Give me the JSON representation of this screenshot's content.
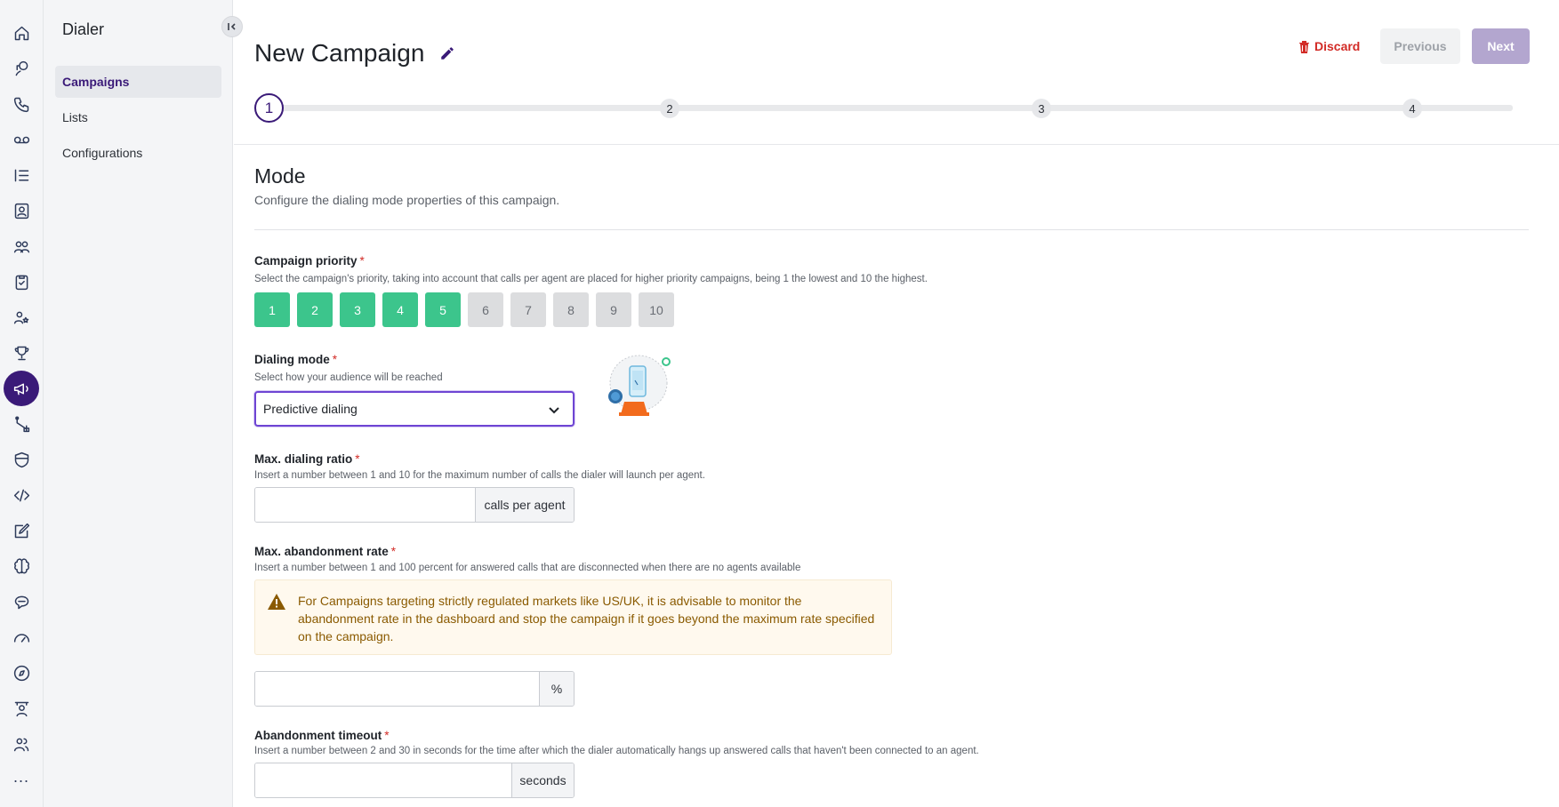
{
  "rail": {
    "icons": [
      "home-icon",
      "agent-icon",
      "phone-icon",
      "voicemail-icon",
      "list-icon",
      "contacts-icon",
      "team-icon",
      "clipboard-icon",
      "users-star-icon",
      "trophy-icon",
      "megaphone-icon",
      "workflow-icon",
      "shield-icon",
      "code-icon",
      "edit-icon",
      "brain-icon",
      "chat-icon",
      "gauge-icon",
      "compass-icon",
      "teacher-icon",
      "people-icon"
    ],
    "more": "..."
  },
  "sidebar": {
    "title": "Dialer",
    "items": [
      {
        "label": "Campaigns",
        "active": true
      },
      {
        "label": "Lists",
        "active": false
      },
      {
        "label": "Configurations",
        "active": false
      }
    ]
  },
  "header": {
    "title": "New Campaign",
    "discard_label": "Discard",
    "previous_label": "Previous",
    "next_label": "Next"
  },
  "stepper": {
    "steps": [
      "1",
      "2",
      "3",
      "4"
    ],
    "current": 1
  },
  "section": {
    "title": "Mode",
    "subtitle": "Configure the dialing mode properties of this campaign."
  },
  "priority": {
    "label": "Campaign priority",
    "required": "*",
    "help": "Select the campaign's priority, taking into account that calls per agent are placed for higher priority campaigns, being 1 the lowest and 10 the highest.",
    "options": [
      "1",
      "2",
      "3",
      "4",
      "5",
      "6",
      "7",
      "8",
      "9",
      "10"
    ],
    "selected": 5
  },
  "dialing_mode": {
    "label": "Dialing mode",
    "required": "*",
    "help": "Select how your audience will be reached",
    "value": "Predictive dialing"
  },
  "max_ratio": {
    "label": "Max. dialing ratio",
    "required": "*",
    "help": "Insert a number between 1 and 10 for the maximum number of calls the dialer will launch per agent.",
    "value": "",
    "addon": "calls per agent"
  },
  "abandon_rate": {
    "label": "Max. abandonment rate",
    "required": "*",
    "help": "Insert a number between 1 and 100 percent for answered calls that are disconnected when there are no agents available",
    "warning": "For Campaigns targeting strictly regulated markets like US/UK, it is advisable to monitor the abandonment rate in the dashboard and stop the campaign if it goes beyond the maximum rate specified on the campaign.",
    "value": "",
    "addon": "%"
  },
  "abandon_timeout": {
    "label": "Abandonment timeout",
    "required": "*",
    "help": "Insert a number between 2 and 30 in seconds for the time after which the dialer automatically hangs up answered calls that haven't been connected to an agent.",
    "value": "",
    "addon": "seconds"
  },
  "colors": {
    "brand": "#3a1a78",
    "priority_on": "#3cc58c",
    "danger": "#d22b26",
    "warning_text": "#8a5a00"
  }
}
